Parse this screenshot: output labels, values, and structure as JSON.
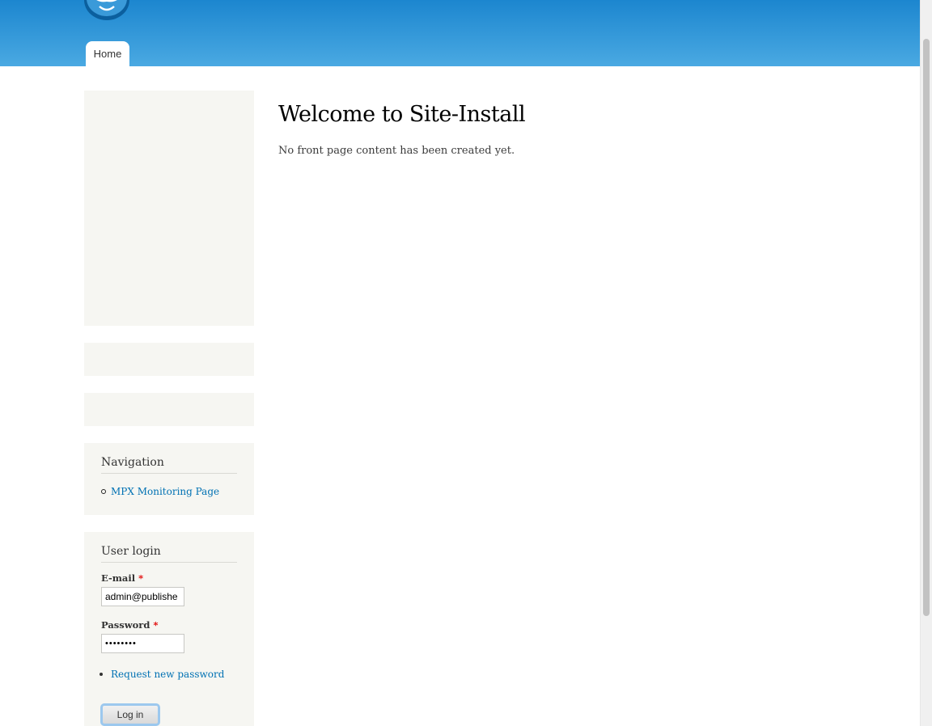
{
  "header": {
    "tabs": [
      {
        "label": "Home"
      }
    ]
  },
  "sidebar": {
    "navigation": {
      "title": "Navigation",
      "items": [
        {
          "label": "MPX Monitoring Page"
        }
      ]
    },
    "user_login": {
      "title": "User login",
      "email_label": "E-mail",
      "email_value": "admin@publishe",
      "password_label": "Password",
      "password_value": "••••••••",
      "required_marker": "*",
      "request_password_link": "Request new password",
      "login_button": "Log in"
    }
  },
  "content": {
    "title": "Welcome to Site-Install",
    "message": "No front page content has been created yet."
  },
  "colors": {
    "header_top": "#1c86cf",
    "header_bottom": "#4aa9e2",
    "link": "#0071b3",
    "sidebar_bg": "#f6f6f2",
    "required": "#e00000"
  }
}
